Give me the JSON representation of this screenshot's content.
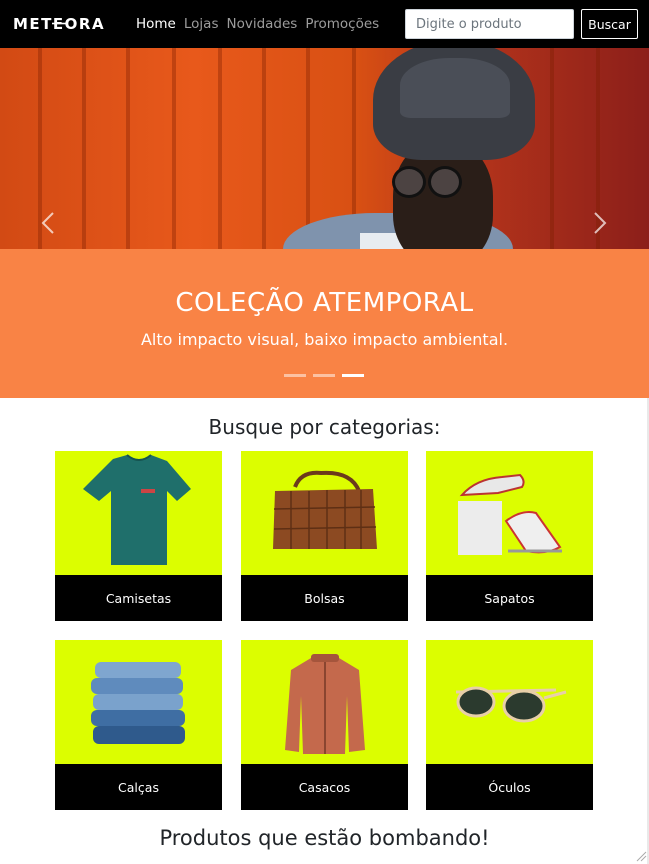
{
  "navbar": {
    "logo": "METEORA",
    "links": [
      {
        "label": "Home",
        "active": true
      },
      {
        "label": "Lojas",
        "active": false
      },
      {
        "label": "Novidades",
        "active": false
      },
      {
        "label": "Promoções",
        "active": false
      }
    ],
    "search": {
      "placeholder": "Digite o produto",
      "value": ""
    },
    "search_button": "Buscar"
  },
  "hero": {
    "title": "COLEÇÃO ATEMPORAL",
    "subtitle": "Alto impacto visual, baixo impacto ambiental.",
    "active_slide": 3,
    "slide_count": 3,
    "prev_icon": "chevron-left-icon",
    "next_icon": "chevron-right-icon"
  },
  "categories": {
    "title": "Busque por categorias:",
    "items": [
      {
        "label": "Camisetas",
        "icon": "tshirt"
      },
      {
        "label": "Bolsas",
        "icon": "handbag"
      },
      {
        "label": "Sapatos",
        "icon": "sneakers"
      },
      {
        "label": "Calças",
        "icon": "jeans"
      },
      {
        "label": "Casacos",
        "icon": "jacket"
      },
      {
        "label": "Óculos",
        "icon": "sunglasses"
      }
    ]
  },
  "trending": {
    "title": "Produtos que estão bombando!"
  },
  "colors": {
    "navbar": "#000000",
    "hero_caption": "#f98345",
    "category_background": "#dcfe00",
    "category_label": "#000000"
  }
}
